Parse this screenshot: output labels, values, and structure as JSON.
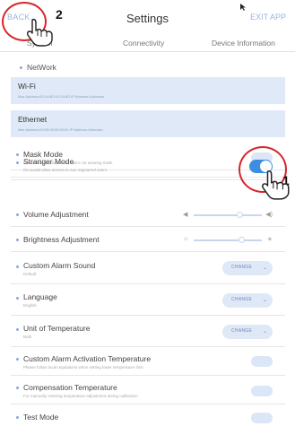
{
  "header": {
    "back_label": "BACK",
    "title": "Settings",
    "exit_label": "EXIT APP"
  },
  "tabs": [
    {
      "label": "System"
    },
    {
      "label": "Connectivity"
    },
    {
      "label": "Device Information"
    }
  ],
  "network": {
    "section_label": "NetWork",
    "wifi": {
      "name": "Wi-Fi",
      "detail": "Mac Address:B1:04:B3:01:04:9D     IP Address:Unknown"
    },
    "ethernet": {
      "name": "Ethernet",
      "detail": "Mac Address:00:00:00:00:00:00     IP Address:Unknown"
    }
  },
  "settings": {
    "mask_mode": {
      "label": "Mask Mode",
      "desc": "On would allow access to users not wearing mask",
      "on": false
    },
    "stranger_mode": {
      "label": "Stranger Mode",
      "desc": "On would allow access to non registered users",
      "on": true
    },
    "volume": {
      "label": "Volume Adjustment",
      "level": 0.7
    },
    "brightness": {
      "label": "Brightness Adjustment",
      "level": 0.72
    },
    "alarm_sound": {
      "label": "Custom Alarm Sound",
      "desc": "Default",
      "button": "CHANGE"
    },
    "language": {
      "label": "Language",
      "desc": "English",
      "button": "CHANGE"
    },
    "temperature_unit": {
      "label": "Unit of Temperature",
      "desc": "Both",
      "button": "CHANGE"
    },
    "alarm_activation": {
      "label": "Custom Alarm Activation Temperature",
      "desc": "Please follow local regulations when setting lower temperature limit",
      "on": false
    },
    "compensation": {
      "label": "Compensation Temperature",
      "desc": "For manually entering temperature adjustment during calibration",
      "on": false
    },
    "test_mode": {
      "label": "Test Mode",
      "on": false
    }
  },
  "annotations": {
    "step_1": "1",
    "step_2": "2"
  },
  "colors": {
    "accent": "#3d8ee0",
    "annotation_circle": "#d6262b",
    "card_bg": "#dfe9f7"
  }
}
